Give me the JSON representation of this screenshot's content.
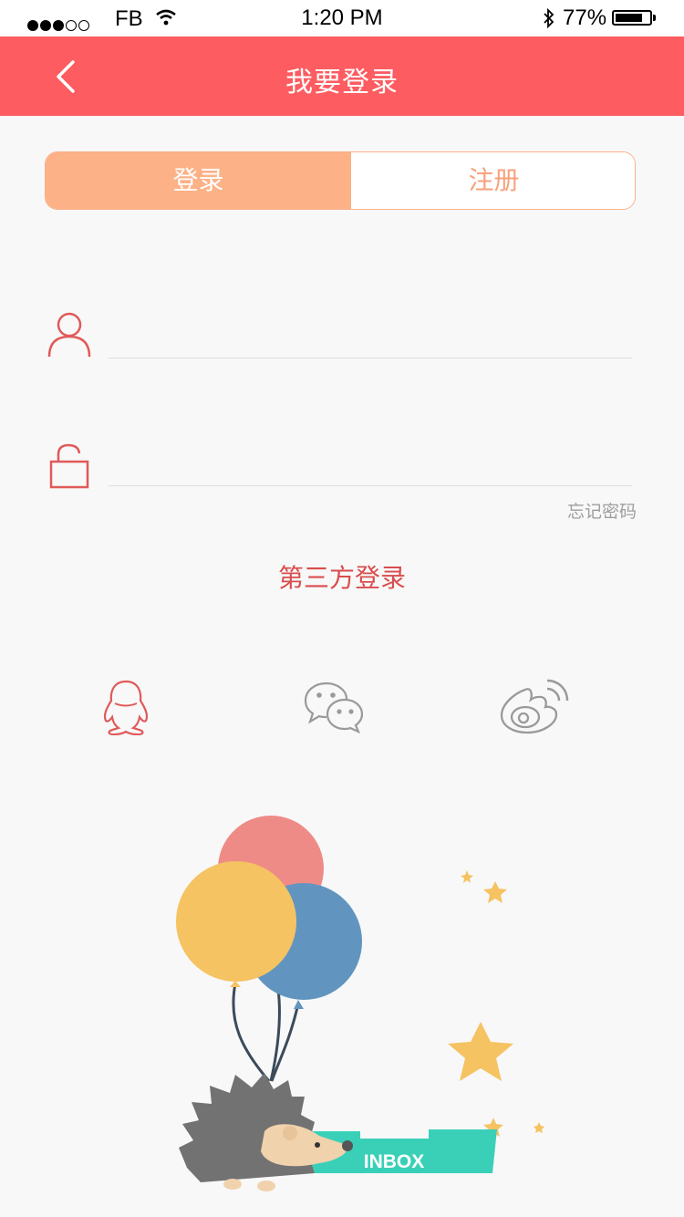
{
  "status_bar": {
    "carrier": "FB",
    "time": "1:20 PM",
    "battery": "77%",
    "battery_level": 0.77
  },
  "nav": {
    "title": "我要登录"
  },
  "tabs": {
    "login": "登录",
    "register": "注册",
    "active": "login"
  },
  "form": {
    "username_value": "",
    "password_value": "",
    "forgot_password": "忘记密码"
  },
  "third_party": {
    "title": "第三方登录",
    "providers": [
      "qq-icon",
      "wechat-icon",
      "weibo-icon"
    ]
  },
  "illustration": {
    "box_label": "INBOX"
  },
  "colors": {
    "nav_bg": "#fd5c60",
    "tab_active": "#fcb186",
    "tab_inactive_text": "#f7a27b",
    "icon_red": "#e05a5a",
    "icon_gray": "#9a9a9a"
  }
}
